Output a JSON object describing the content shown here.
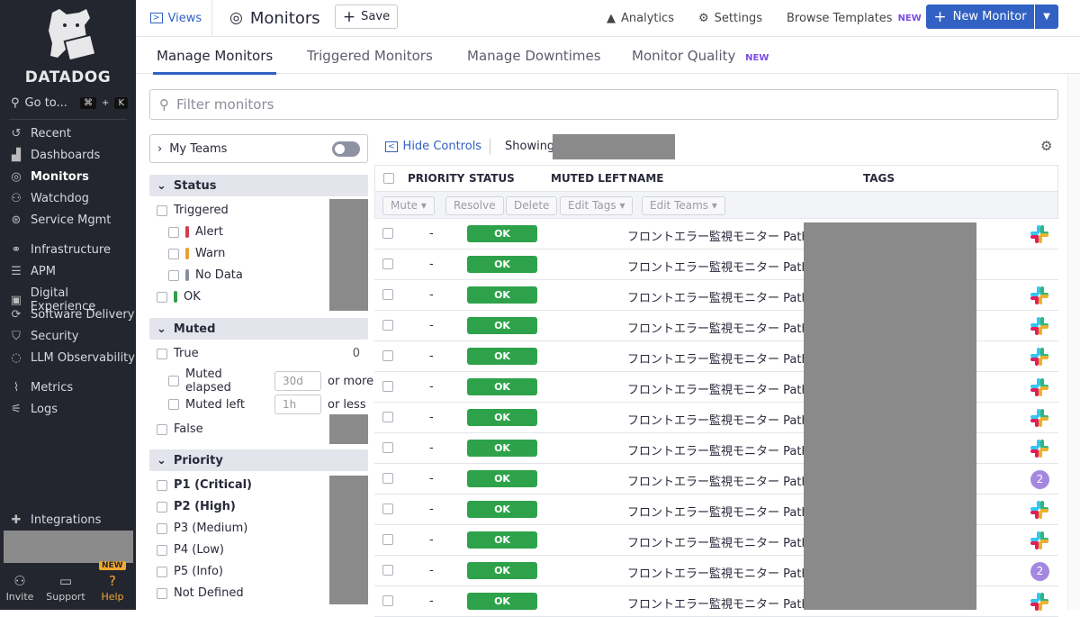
{
  "sidebar": {
    "brand": "DATADOG",
    "goto": "Go to...",
    "shortcut_cmd": "⌘",
    "shortcut_plus": "+",
    "shortcut_key": "K",
    "items": [
      {
        "label": "Recent",
        "icon": "clock-icon"
      },
      {
        "label": "Dashboards",
        "icon": "chart-icon"
      },
      {
        "label": "Monitors",
        "icon": "monitor-icon"
      },
      {
        "label": "Watchdog",
        "icon": "dog-icon"
      },
      {
        "label": "Service Mgmt",
        "icon": "service-icon"
      },
      {
        "label": "Infrastructure",
        "icon": "infra-icon"
      },
      {
        "label": "APM",
        "icon": "apm-icon"
      },
      {
        "label": "Digital Experience",
        "icon": "dx-icon"
      },
      {
        "label": "Software Delivery",
        "icon": "delivery-icon"
      },
      {
        "label": "Security",
        "icon": "shield-icon"
      },
      {
        "label": "LLM Observability",
        "icon": "llm-icon"
      },
      {
        "label": "Metrics",
        "icon": "metrics-icon"
      },
      {
        "label": "Logs",
        "icon": "logs-icon"
      },
      {
        "label": "Integrations",
        "icon": "puzzle-icon"
      }
    ],
    "bottom": {
      "invite": "Invite",
      "support": "Support",
      "help": "Help",
      "help_badge": "NEW"
    }
  },
  "header": {
    "views": "Views",
    "title": "Monitors",
    "save": "Save",
    "analytics": "Analytics",
    "settings": "Settings",
    "browse": "Browse Templates",
    "browse_badge": "NEW",
    "new_monitor": "New Monitor"
  },
  "tabs": [
    {
      "label": "Manage Monitors"
    },
    {
      "label": "Triggered Monitors"
    },
    {
      "label": "Manage Downtimes"
    },
    {
      "label": "Monitor Quality",
      "badge": "NEW"
    }
  ],
  "filter": {
    "placeholder": "Filter monitors"
  },
  "facets": {
    "my_teams": "My Teams",
    "status": {
      "title": "Status",
      "triggered": "Triggered",
      "alert": "Alert",
      "warn": "Warn",
      "nodata": "No Data",
      "ok": "OK"
    },
    "muted": {
      "title": "Muted",
      "true": "True",
      "true_count": "0",
      "elapsed": "Muted elapsed",
      "elapsed_ph": "30d",
      "or_more": "or more",
      "left": "Muted left",
      "left_ph": "1h",
      "or_less": "or less",
      "false": "False"
    },
    "priority": {
      "title": "Priority",
      "items": [
        "P1 (Critical)",
        "P2 (High)",
        "P3 (Medium)",
        "P4 (Low)",
        "P5 (Info)",
        "Not Defined"
      ]
    }
  },
  "controls": {
    "hide": "Hide Controls",
    "showing": "Showing"
  },
  "table": {
    "headers": {
      "priority": "PRIORITY",
      "status": "STATUS",
      "muted_left": "MUTED LEFT",
      "name": "NAME",
      "tags": "TAGS"
    },
    "actions": {
      "mute": "Mute",
      "resolve": "Resolve",
      "delete": "Delete",
      "edit_tags": "Edit Tags",
      "edit_teams": "Edit Teams"
    },
    "rows": [
      {
        "priority": "-",
        "status": "OK",
        "name": "フロントエラー監視モニター Path:",
        "tag": "slack"
      },
      {
        "priority": "-",
        "status": "OK",
        "name": "フロントエラー監視モニター Path:",
        "tag": ""
      },
      {
        "priority": "-",
        "status": "OK",
        "name": "フロントエラー監視モニター Path:",
        "tag": "slack"
      },
      {
        "priority": "-",
        "status": "OK",
        "name": "フロントエラー監視モニター Path:",
        "tag": "slack"
      },
      {
        "priority": "-",
        "status": "OK",
        "name": "フロントエラー監視モニター Path:",
        "tag": "slack"
      },
      {
        "priority": "-",
        "status": "OK",
        "name": "フロントエラー監視モニター Path:",
        "tag": "slack"
      },
      {
        "priority": "-",
        "status": "OK",
        "name": "フロントエラー監視モニター Path:",
        "tag": "slack"
      },
      {
        "priority": "-",
        "status": "OK",
        "name": "フロントエラー監視モニター Path:",
        "tag": "slack"
      },
      {
        "priority": "-",
        "status": "OK",
        "name": "フロントエラー監視モニター Path:",
        "tag": "2"
      },
      {
        "priority": "-",
        "status": "OK",
        "name": "フロントエラー監視モニター Path:",
        "tag": "slack"
      },
      {
        "priority": "-",
        "status": "OK",
        "name": "フロントエラー監視モニター Path:",
        "tag": "slack"
      },
      {
        "priority": "-",
        "status": "OK",
        "name": "フロントエラー監視モニター Path:",
        "tag": "2"
      },
      {
        "priority": "-",
        "status": "OK",
        "name": "フロントエラー監視モニター Path:",
        "tag": "slack"
      }
    ]
  },
  "colors": {
    "accent": "#3161c3",
    "ok": "#2ea24a",
    "alert": "#d33d4d",
    "warn": "#e9a12c",
    "nodata": "#8a8ca0",
    "sidebar": "#24262f",
    "new_badge": "#7a4be8",
    "help": "#f0a830"
  }
}
